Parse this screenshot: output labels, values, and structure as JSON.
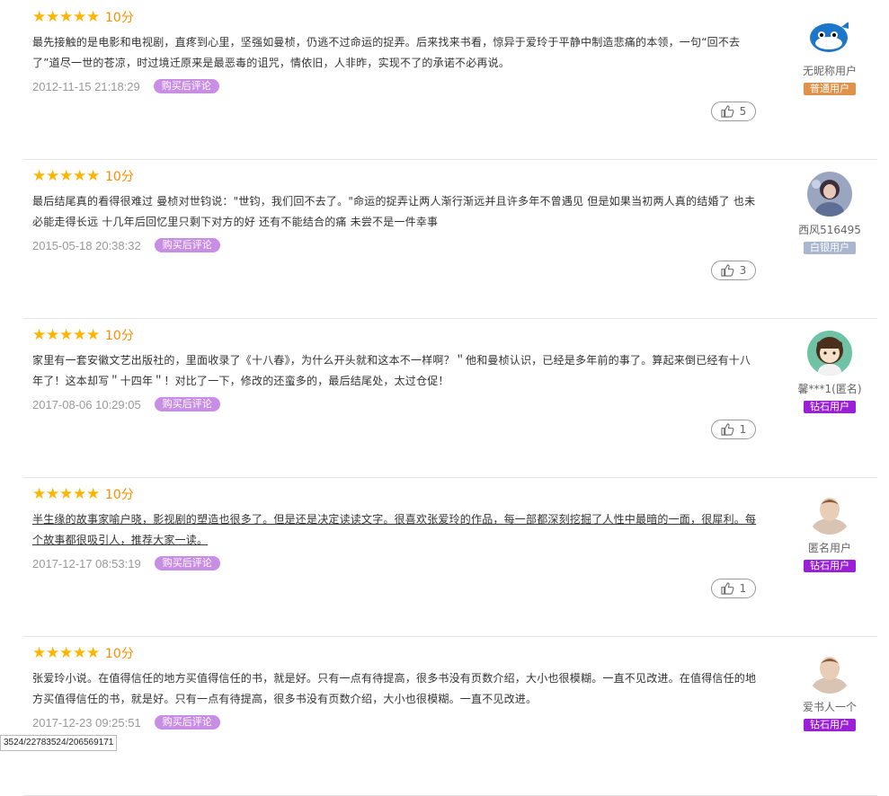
{
  "reviews": [
    {
      "stars": 5,
      "score": "10分",
      "content": "最先接触的是电影和电视剧，直疼到心里，坚强如曼桢，仍逃不过命运的捉弄。后来找来书看，惊异于爱玲于平静中制造悲痛的本领，一句“回不去了”道尽一世的苍凉，时过境迁原来是最恶毒的诅咒，情依旧，人非昨，实现不了的承诺不必再说。",
      "date": "2012-11-15 21:18:29",
      "badge": "购买后评论",
      "likes": "5",
      "username": "无昵称用户",
      "level": "普通用户",
      "level_color": "#e0914a",
      "avatar": "whale"
    },
    {
      "stars": 5,
      "score": "10分",
      "content": "最后结尾真的看得很难过 曼桢对世钧说：\"世钧，我们回不去了。\"命运的捉弄让两人渐行渐远并且许多年不曾遇见 但是如果当初两人真的结婚了 也未必能走得长远 十几年后回忆里只剩下对方的好 还有不能结合的痛 未尝不是一件幸事",
      "date": "2015-05-18 20:38:32",
      "badge": "购买后评论",
      "likes": "3",
      "username": "西风516495",
      "level": "白银用户",
      "level_color": "#a9b6cf",
      "avatar": "photo"
    },
    {
      "stars": 5,
      "score": "10分",
      "content": "家里有一套安徽文艺出版社的，里面收录了《十八春》，为什么开头就和这本不一样啊？＂他和曼桢认识，已经是多年前的事了。算起来倒已经有十八年了！这本却写＂十四年＂！对比了一下，修改的还蛮多的，最后结尾处，太过仓促！",
      "date": "2017-08-06 10:29:05",
      "badge": "购买后评论",
      "likes": "1",
      "username": "馨***1(匿名)",
      "level": "钻石用户",
      "level_color": "#9b1fd6",
      "avatar": "girl"
    },
    {
      "stars": 5,
      "score": "10分",
      "content": "半生缘的故事家喻户晓，影视剧的塑造也很多了。但是还是决定读读文字。很喜欢张爱玲的作品，每一部都深刻挖掘了人性中最暗的一面，很犀利。每个故事都很吸引人，推荐大家一读。",
      "date": "2017-12-17 08:53:19",
      "badge": "购买后评论",
      "likes": "1",
      "username": "匿名用户",
      "level": "钻石用户",
      "level_color": "#9b1fd6",
      "avatar": "default"
    },
    {
      "stars": 5,
      "score": "10分",
      "content": "张爱玲小说。在值得信任的地方买值得信任的书，就是好。只有一点有待提高，很多书没有页数介绍，大小也很模糊。一直不见改进。在值得信任的地方买值得信任的书，就是好。只有一点有待提高，很多书没有页数介绍，大小也很模糊。一直不见改进。",
      "date": "2017-12-23 09:25:51",
      "badge": "购买后评论",
      "likes": "",
      "username": "爱书人一个",
      "level": "钻石用户",
      "level_color": "#9b1fd6",
      "avatar": "default"
    }
  ],
  "status_bar": "3524/22783524/206569171"
}
